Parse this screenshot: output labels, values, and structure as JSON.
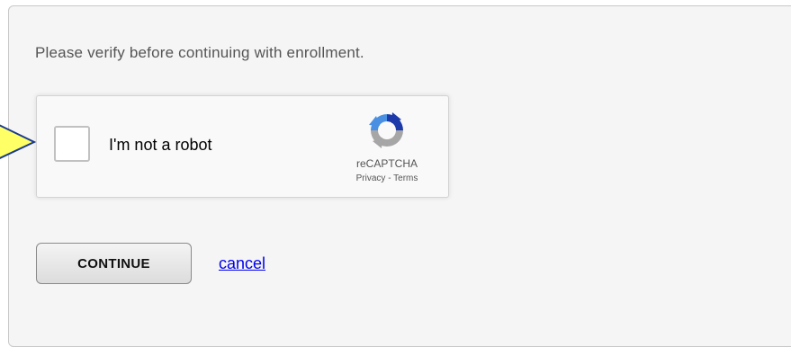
{
  "form": {
    "prompt": "Please verify before continuing with enrollment."
  },
  "captcha": {
    "label": "I'm not a robot",
    "checked": false,
    "brand_name": "reCAPTCHA",
    "privacy_label": "Privacy",
    "separator": " - ",
    "terms_label": "Terms",
    "logo_icon": "recaptcha-logo-icon"
  },
  "actions": {
    "continue_label": "CONTINUE",
    "cancel_label": "cancel"
  },
  "colors": {
    "link": "#0000ee",
    "pointer_fill": "#ffff66",
    "pointer_stroke": "#1a3a8f",
    "logo_blue_dark": "#1c3aa9",
    "logo_blue": "#4a90e2",
    "logo_gray": "#a6a6a6"
  }
}
